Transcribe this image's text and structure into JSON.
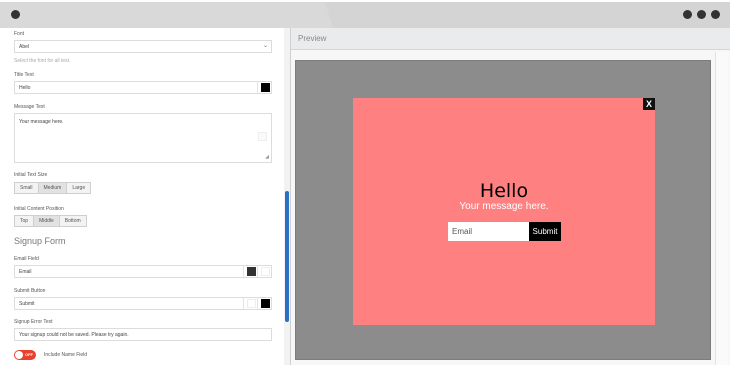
{
  "colors": {
    "accent": "#2d6fc2",
    "popup_bg": "#ff8080",
    "canvas_bg": "#8c8c8c",
    "toggle_off": "#e8412d"
  },
  "settings": {
    "font": {
      "label": "Font",
      "value": "Abel",
      "hint": "Select the font for all text."
    },
    "title_text": {
      "label": "Title Text",
      "value": "Hello",
      "color": "#000000"
    },
    "message_text": {
      "label": "Message Text",
      "value": "Your message here."
    },
    "text_size": {
      "label": "Initial Text Size",
      "options": [
        "Small",
        "Medium",
        "Large"
      ],
      "selected": "Medium"
    },
    "content_position": {
      "label": "Initial Content Position",
      "options": [
        "Top",
        "Middle",
        "Bottom"
      ],
      "selected": "Middle"
    },
    "signup_section": "Signup Form",
    "email_field": {
      "label": "Email Field",
      "value": "Email",
      "color": "#333333"
    },
    "submit_button": {
      "label": "Submit Button",
      "value": "Submit",
      "color": "#000000"
    },
    "error_text": {
      "label": "Signup Error Text",
      "value": "Your signup could not be saved. Please try again."
    },
    "name_field": {
      "label": "Include Name Field",
      "toggle": "OFF"
    }
  },
  "preview": {
    "header": "Preview",
    "close": "X",
    "title": "Hello",
    "message": "Your message here.",
    "email_placeholder": "Email",
    "submit": "Submit"
  }
}
